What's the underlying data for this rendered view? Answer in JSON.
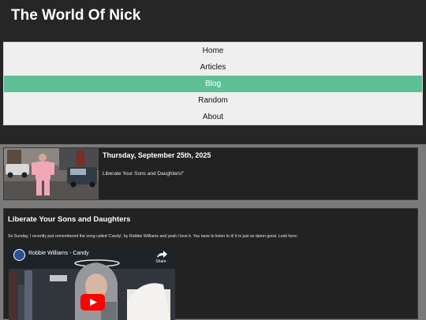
{
  "site": {
    "title": "The World Of Nick"
  },
  "nav": {
    "items": [
      {
        "label": "Home",
        "active": false
      },
      {
        "label": "Articles",
        "active": false
      },
      {
        "label": "Blog",
        "active": true
      },
      {
        "label": "Random",
        "active": false
      },
      {
        "label": "About",
        "active": false
      }
    ]
  },
  "post": {
    "date": "Thursday, September 25th, 2025",
    "excerpt": "Liberate Your Sons and Daughters!\""
  },
  "article": {
    "title": "Liberate Your Sons and Daughters",
    "body": "So Sunday, I recently just remembered the song called 'Candy', by Robbie Williams and yeah I love it. You have to listen to it! It is just so damn good. Look here:",
    "video": {
      "title": "Robbie Williams - Candy",
      "share_label": "Share"
    }
  },
  "colors": {
    "header_bg": "#262626",
    "page_bg": "#7a7a7a",
    "nav_bg": "#efefef",
    "nav_active": "#5fbf97",
    "card_bg": "#222222",
    "youtube_red": "#ff0000"
  }
}
